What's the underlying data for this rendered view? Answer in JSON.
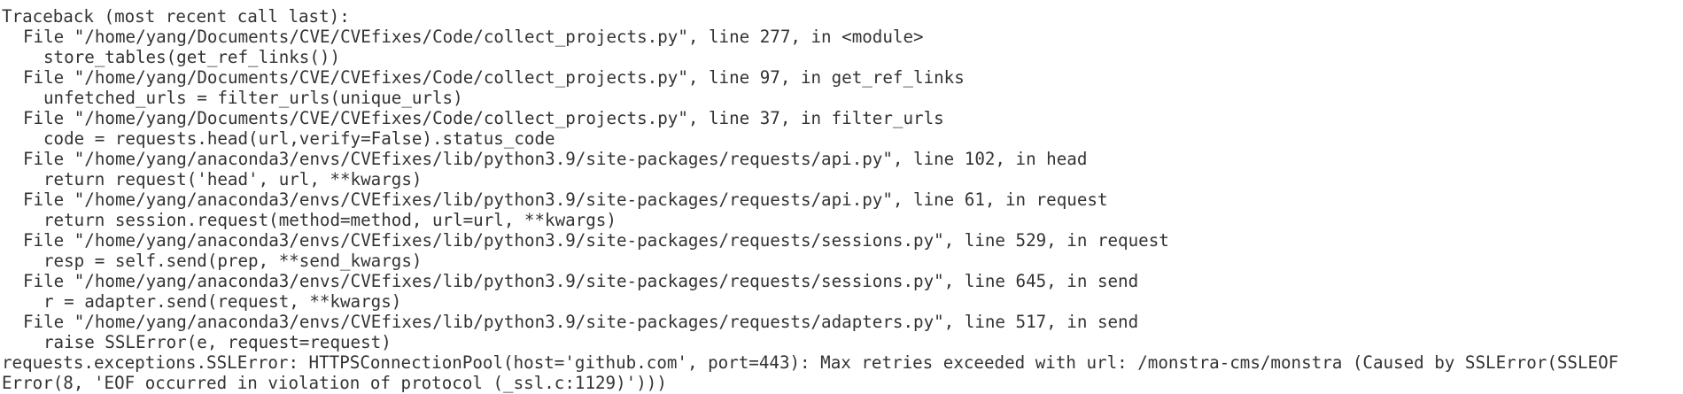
{
  "traceback": {
    "header": "Traceback (most recent call last):",
    "frames": [
      {
        "file_line": "File \"/home/yang/Documents/CVE/CVEfixes/Code/collect_projects.py\", line 277, in <module>",
        "code": "store_tables(get_ref_links())"
      },
      {
        "file_line": "File \"/home/yang/Documents/CVE/CVEfixes/Code/collect_projects.py\", line 97, in get_ref_links",
        "code": "unfetched_urls = filter_urls(unique_urls)"
      },
      {
        "file_line": "File \"/home/yang/Documents/CVE/CVEfixes/Code/collect_projects.py\", line 37, in filter_urls",
        "code": "code = requests.head(url,verify=False).status_code"
      },
      {
        "file_line": "File \"/home/yang/anaconda3/envs/CVEfixes/lib/python3.9/site-packages/requests/api.py\", line 102, in head",
        "code": "return request('head', url, **kwargs)"
      },
      {
        "file_line": "File \"/home/yang/anaconda3/envs/CVEfixes/lib/python3.9/site-packages/requests/api.py\", line 61, in request",
        "code": "return session.request(method=method, url=url, **kwargs)"
      },
      {
        "file_line": "File \"/home/yang/anaconda3/envs/CVEfixes/lib/python3.9/site-packages/requests/sessions.py\", line 529, in request",
        "code": "resp = self.send(prep, **send_kwargs)"
      },
      {
        "file_line": "File \"/home/yang/anaconda3/envs/CVEfixes/lib/python3.9/site-packages/requests/sessions.py\", line 645, in send",
        "code": "r = adapter.send(request, **kwargs)"
      },
      {
        "file_line": "File \"/home/yang/anaconda3/envs/CVEfixes/lib/python3.9/site-packages/requests/adapters.py\", line 517, in send",
        "code": "raise SSLError(e, request=request)"
      }
    ],
    "error_line_1": "requests.exceptions.SSLError: HTTPSConnectionPool(host='github.com', port=443): Max retries exceeded with url: /monstra-cms/monstra (Caused by SSLError(SSLEOF",
    "error_line_2": "Error(8, 'EOF occurred in violation of protocol (_ssl.c:1129)')))"
  }
}
